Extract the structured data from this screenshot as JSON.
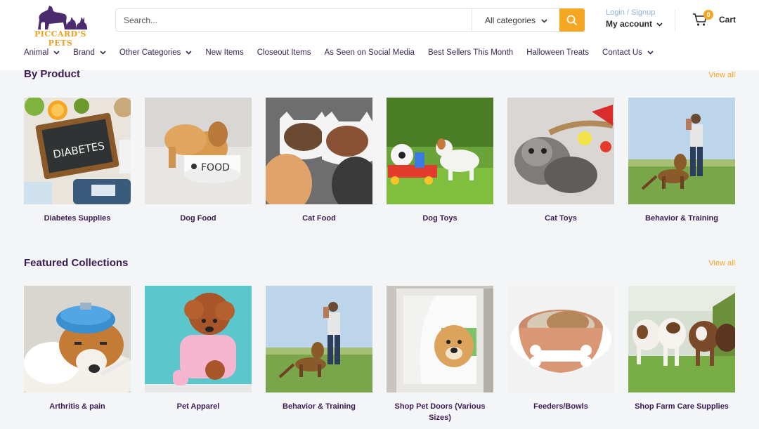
{
  "header": {
    "logo_text": "PICCARD'S PETS",
    "search": {
      "placeholder": "Search...",
      "category": "All categories"
    },
    "account": {
      "login": "Login / Signup",
      "label": "My account"
    },
    "cart": {
      "count": "0",
      "label": "Cart"
    }
  },
  "nav": [
    {
      "label": "Animal",
      "dropdown": true
    },
    {
      "label": "Brand",
      "dropdown": true
    },
    {
      "label": "Other Categories",
      "dropdown": true
    },
    {
      "label": "New Items",
      "dropdown": false
    },
    {
      "label": "Closeout Items",
      "dropdown": false
    },
    {
      "label": "As Seen on Social Media",
      "dropdown": false
    },
    {
      "label": "Best Sellers This Month",
      "dropdown": false
    },
    {
      "label": "Halloween Treats",
      "dropdown": false
    },
    {
      "label": "Contact Us",
      "dropdown": true
    }
  ],
  "by_product": {
    "title": "By Product",
    "view_all": "View all",
    "items": [
      {
        "label": "Diabetes Supplies"
      },
      {
        "label": "Dog Food"
      },
      {
        "label": "Cat Food"
      },
      {
        "label": "Dog Toys"
      },
      {
        "label": "Cat Toys"
      },
      {
        "label": "Behavior & Training"
      }
    ]
  },
  "featured": {
    "title": "Featured Collections",
    "view_all": "View all",
    "items": [
      {
        "label": "Arthritis & pain"
      },
      {
        "label": "Pet Apparel"
      },
      {
        "label": "Behavior & Training"
      },
      {
        "label": "Shop Pet Doors (Various Sizes)"
      },
      {
        "label": "Feeders/Bowls"
      },
      {
        "label": "Shop Farm Care Supplies"
      }
    ]
  },
  "colors": {
    "brand": "#3c1b55",
    "accent": "#f5a623",
    "link": "#8fb3d9"
  }
}
